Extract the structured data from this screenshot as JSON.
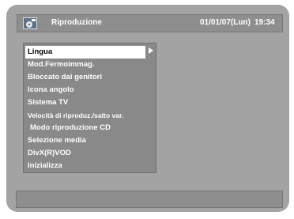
{
  "header": {
    "icon": "disc-setup-icon",
    "title": "Riproduzione",
    "date": "01/01/07(Lun)",
    "time": "19:34"
  },
  "menu": {
    "items": [
      {
        "label": "Lingua",
        "selected": true
      },
      {
        "label": "Mod.Fermoimmag.",
        "selected": false
      },
      {
        "label": "Bloccato dai genitori",
        "selected": false
      },
      {
        "label": "Icona angolo",
        "selected": false
      },
      {
        "label": "Sistema TV",
        "selected": false
      },
      {
        "label": "Velocità di riproduz./salto var.",
        "selected": false
      },
      {
        "label": "Modo riproduzione CD",
        "selected": false
      },
      {
        "label": "Selezione media",
        "selected": false
      },
      {
        "label": "DivX(R)VOD",
        "selected": false
      },
      {
        "label": "Inizializza",
        "selected": false
      }
    ],
    "submenu_icon": "chevron-right-icon"
  },
  "footer": {
    "text": ""
  }
}
